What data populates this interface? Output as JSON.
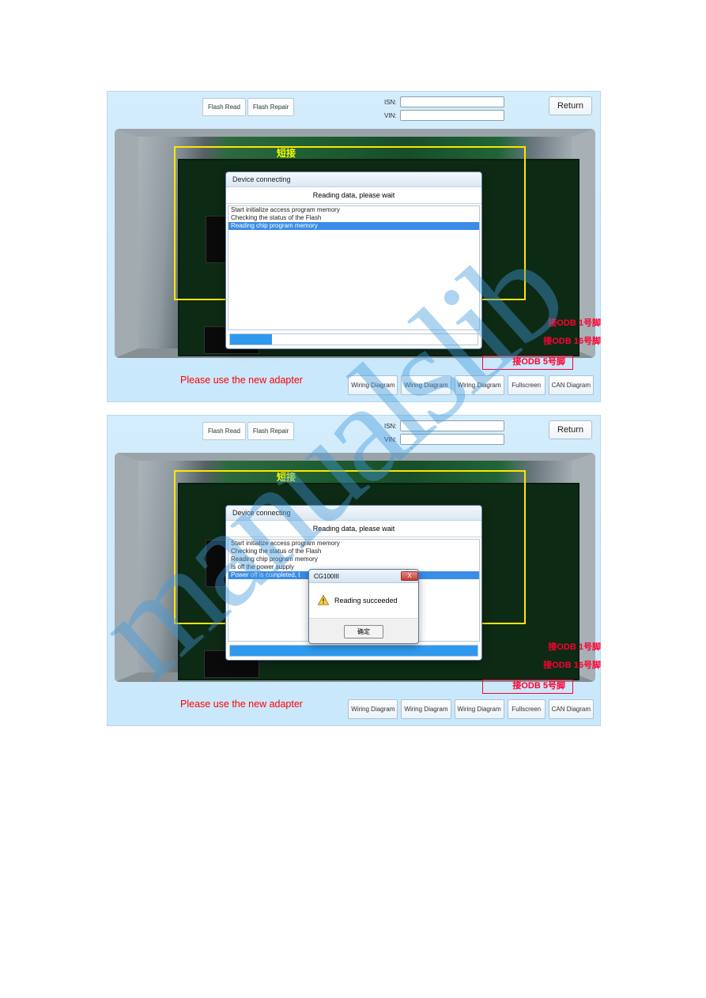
{
  "watermark": "manualslib",
  "screen1": {
    "buttons": {
      "flash_read": "Flash Read",
      "flash_repair": "Flash Repair"
    },
    "fields": {
      "isn_label": "ISN:",
      "vin_label": "VIN:",
      "isn_value": "",
      "vin_value": ""
    },
    "return_label": "Return",
    "overlay": {
      "short_label": "短接",
      "annot_1": "接ODB 1号脚",
      "annot_16": "接ODB 16号脚",
      "annot_5": "接ODB 5号脚"
    },
    "footer_message": "Please use the new adapter",
    "footer_buttons": [
      "Wiring Diagram",
      "Wiring Diagram",
      "Wiring Diagram",
      "Fullscreen",
      "CAN Diagram"
    ],
    "dialog": {
      "title": "Device connecting",
      "subtitle": "Reading data, please wait",
      "rows": [
        {
          "text": "Start initialize access program memory",
          "selected": false
        },
        {
          "text": "Checking the status of the Flash",
          "selected": false
        },
        {
          "text": "Reading chip program memory",
          "selected": true
        }
      ],
      "progress_percent": 17
    }
  },
  "screen2": {
    "buttons": {
      "flash_read": "Flash Read",
      "flash_repair": "Flash Repair"
    },
    "fields": {
      "isn_label": "ISN:",
      "vin_label": "VIN:",
      "isn_value": "",
      "vin_value": ""
    },
    "return_label": "Return",
    "overlay": {
      "short_label": "短接",
      "annot_1": "接ODB 1号脚",
      "annot_16": "接ODB 16号脚",
      "annot_5": "接ODB 5号脚"
    },
    "footer_message": "Please use the new adapter",
    "footer_buttons": [
      "Wiring Diagram",
      "Wiring Diagram",
      "Wiring Diagram",
      "Fullscreen",
      "CAN Diagram"
    ],
    "dialog": {
      "title": "Device connecting",
      "subtitle": "Reading data, please wait",
      "rows": [
        {
          "text": "Start initialize access program memory",
          "selected": false
        },
        {
          "text": "Checking the status of the Flash",
          "selected": false
        },
        {
          "text": "Reading chip program memory",
          "selected": false
        },
        {
          "text": "Is off the power supply",
          "selected": false
        },
        {
          "text": "Power off is completed, t",
          "selected": true
        }
      ],
      "progress_percent": 100
    },
    "msgbox": {
      "title": "CG100III",
      "message": "Reading succeeded",
      "ok_label": "确定",
      "close_label": "X"
    }
  }
}
